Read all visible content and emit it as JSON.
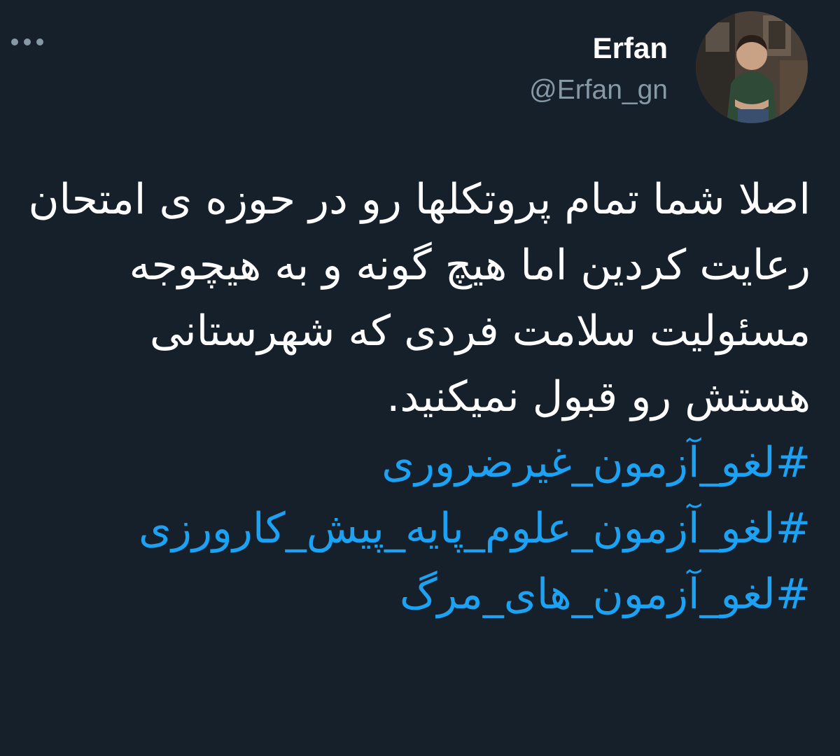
{
  "header": {
    "display_name": "Erfan",
    "handle": "@Erfan_gn"
  },
  "actions": {
    "more_icon": "more-horizontal-icon"
  },
  "tweet": {
    "text": "اصلا شما تمام پروتکلها رو در حوزه ی امتحان رعایت کردین اما هیچ گونه و به هیچوجه  مسئولیت سلامت فردی که شهرستانی هستش رو قبول نمیکنید.",
    "hashtags": [
      "#لغو_آزمون_غیرضروری",
      "#لغو_آزمون_علوم_پایه_پیش_کارورزی",
      "#لغو_آزمون_های_مرگ"
    ]
  },
  "colors": {
    "background": "#15202b",
    "text": "#ffffff",
    "secondary": "#8899a6",
    "link": "#1da1f2"
  }
}
